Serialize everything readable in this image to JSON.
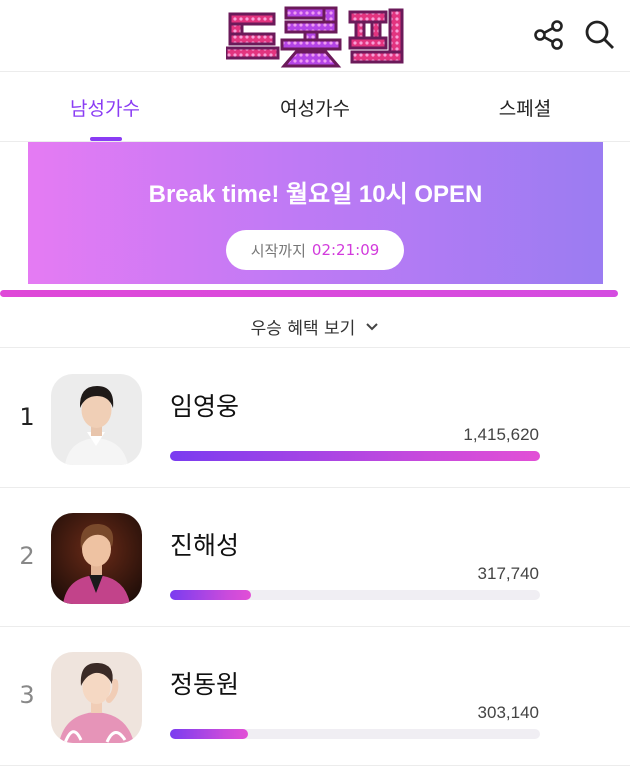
{
  "header": {
    "logo_text": "트롯픽",
    "share_icon": "share-icon",
    "search_icon": "search-icon"
  },
  "tabs": [
    {
      "label": "남성가수",
      "active": true
    },
    {
      "label": "여성가수",
      "active": false
    },
    {
      "label": "스페셜",
      "active": false
    }
  ],
  "banner": {
    "title": "Break time! 월요일 10시 OPEN",
    "countdown_label": "시작까지",
    "countdown_time": "02:21:09"
  },
  "benefits_label": "우승 혜택 보기",
  "ranking": [
    {
      "rank": "1",
      "name": "임영웅",
      "votes": "1,415,620",
      "vote_value": 1415620,
      "bar_fraction": 1.0
    },
    {
      "rank": "2",
      "name": "진해성",
      "votes": "317,740",
      "vote_value": 317740,
      "bar_fraction": 0.22
    },
    {
      "rank": "3",
      "name": "정동원",
      "votes": "303,140",
      "vote_value": 303140,
      "bar_fraction": 0.21
    }
  ],
  "colors": {
    "accent": "#8a3cf4",
    "bar_start": "#7a3cf0",
    "bar_end": "#e24fd6",
    "countdown": "#d23bdc"
  }
}
